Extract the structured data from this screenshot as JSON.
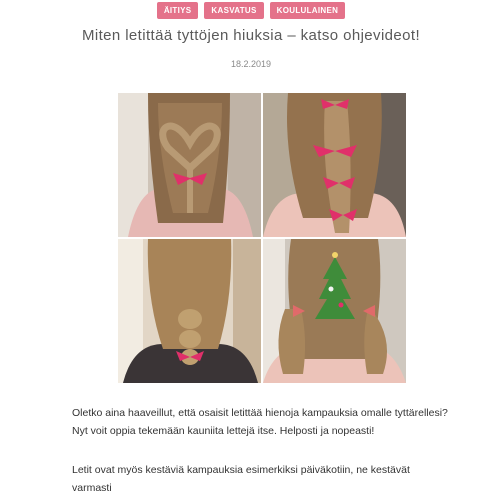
{
  "tags": [
    "ÄITIYS",
    "KASVATUS",
    "KOULULAINEN"
  ],
  "title": "Miten letittää tyttöjen hiuksia – katso ohjevideot!",
  "date": "18.2.2019",
  "photos": [
    {
      "name": "heart-braid-photo"
    },
    {
      "name": "ribbon-braid-photo"
    },
    {
      "name": "bubble-braid-photo"
    },
    {
      "name": "christmas-tree-hairstyle-photo"
    }
  ],
  "paragraphs": [
    "Oletko aina haaveillut, että osaisit letittää hienoja kampauksia omalle tyttärellesi? Nyt voit oppia tekemään kauniita lettejä itse. Helposti ja nopeasti!",
    "Letit ovat myös kestäviä kampauksia esimerkiksi päiväkotiin, ne kestävät varmasti"
  ],
  "colors": {
    "accent": "#e4728a",
    "hair": "#8a6a4a",
    "ribbon": "#e0306a"
  }
}
